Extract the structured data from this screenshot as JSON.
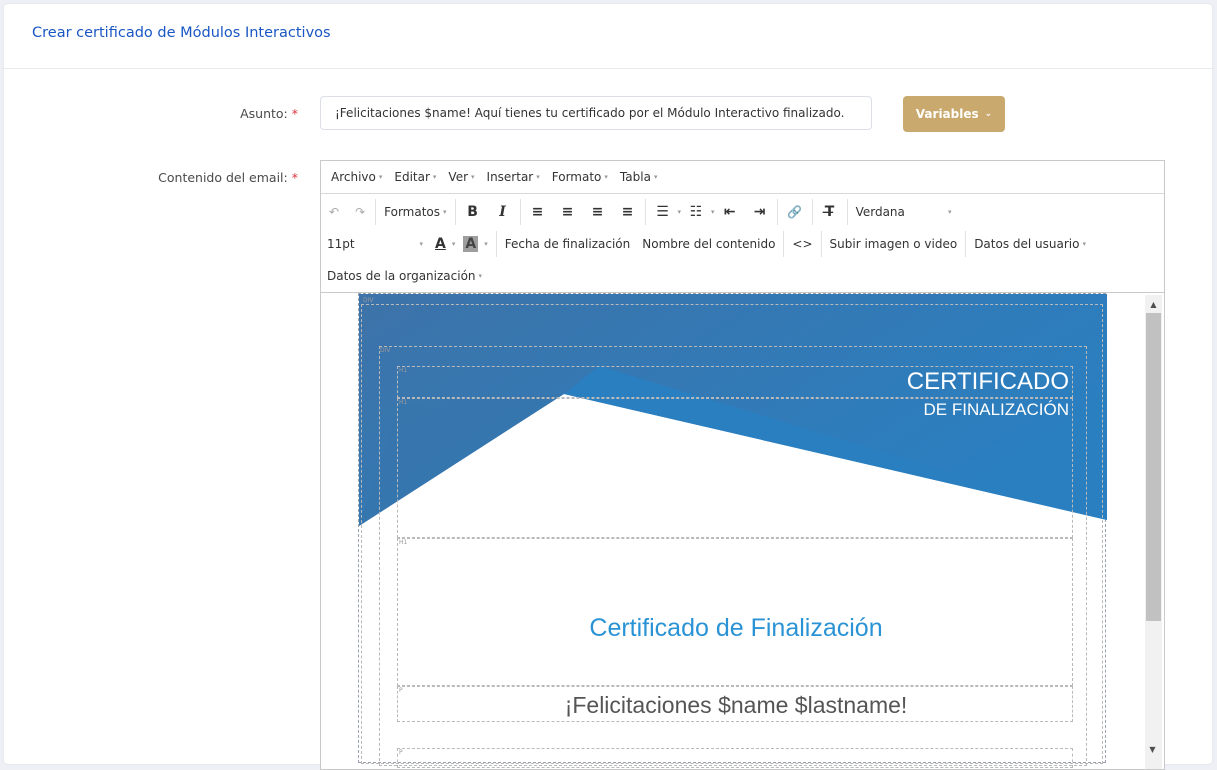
{
  "page": {
    "title": "Crear certificado de Módulos Interactivos"
  },
  "form": {
    "subject_label": "Asunto:",
    "subject_value": "¡Felicitaciones $name! Aquí tienes tu certificado por el Módulo Interactivo finalizado.",
    "variables_label": "Variables",
    "content_label": "Contenido del email:",
    "required_mark": "*"
  },
  "editor": {
    "menu": [
      "Archivo",
      "Editar",
      "Ver",
      "Insertar",
      "Formato",
      "Tabla"
    ],
    "formats_label": "Formatos",
    "font_family": "Verdana",
    "font_size": "11pt",
    "buttons": {
      "fecha": "Fecha de finalización",
      "nombre": "Nombre del contenido",
      "subir": "Subir imagen o video",
      "datos_usuario": "Datos del usuario",
      "datos_org": "Datos de la organización"
    },
    "icons": {
      "undo": "↶",
      "redo": "↷",
      "bold": "B",
      "italic": "I",
      "align_left": "≡",
      "align_center": "≡",
      "align_right": "≡",
      "justify": "≡",
      "bullet_list": "☰",
      "numbered_list": "☷",
      "outdent": "⇤",
      "indent": "⇥",
      "link": "🔗",
      "clear_format": "T̶",
      "font_color": "A",
      "bg_color": "A",
      "code": "<>",
      "caret": "▾",
      "scroll_up": "▲",
      "scroll_down": "▼"
    }
  },
  "certificate": {
    "heading_main": "CERTIFICADO",
    "heading_sub": "DE FINALIZACIÓN",
    "title": "Certificado de Finalización",
    "greeting": "¡Felicitaciones $name $lastname!",
    "tags": {
      "div": "DIV",
      "h1": "H1",
      "p": "P"
    },
    "colors": {
      "primary_blue": "#2a7fc0",
      "title_blue": "#2a93d5"
    }
  }
}
